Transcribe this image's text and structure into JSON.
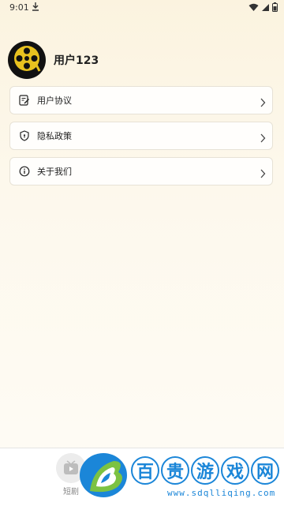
{
  "status_bar": {
    "time": "9:01",
    "download_icon": "download-icon",
    "wifi_icon": "wifi-icon",
    "signal_icon": "signal-icon",
    "battery_icon": "battery-icon"
  },
  "profile": {
    "avatar_icon": "film-reel-icon",
    "username": "用户123"
  },
  "menu": {
    "items": [
      {
        "label": "用户协议",
        "icon": "document-edit-icon"
      },
      {
        "label": "隐私政策",
        "icon": "shield-icon"
      },
      {
        "label": "关于我们",
        "icon": "info-icon"
      }
    ]
  },
  "bottom_nav": {
    "tab_label": "短剧",
    "tab_icon": "play-video-icon"
  },
  "watermark": {
    "chars": [
      "百",
      "贵",
      "游",
      "戏",
      "网"
    ],
    "url": "www.sdqlliqing.com"
  },
  "colors": {
    "background_top": "#fbf3df",
    "watermark_blue": "#1b86d8",
    "watermark_green": "#7cc242"
  }
}
